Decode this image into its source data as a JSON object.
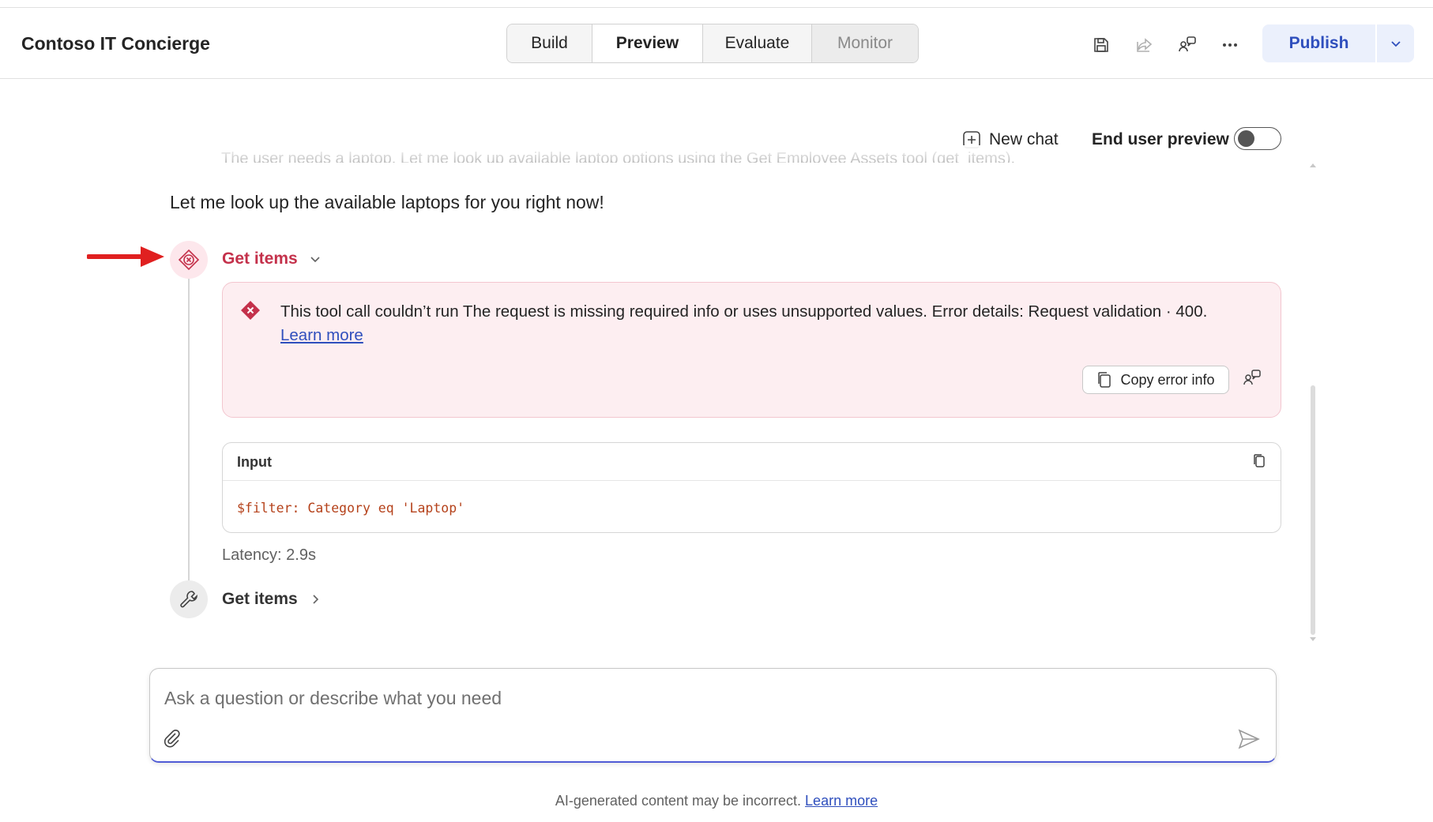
{
  "app": {
    "title": "Contoso IT Concierge"
  },
  "tabs": [
    {
      "label": "Build"
    },
    {
      "label": "Preview"
    },
    {
      "label": "Evaluate"
    },
    {
      "label": "Monitor"
    }
  ],
  "toolbar": {
    "icons": [
      "save-icon",
      "share-icon",
      "feedback-icon",
      "more-icon"
    ],
    "publish_label": "Publish"
  },
  "chat": {
    "new_chat_label": "New chat",
    "end_user_preview_label": "End user preview",
    "end_user_preview_on": false,
    "faded_text": "The user needs a laptop. Let me look up available laptop options using the Get Employee Assets tool (get_items).",
    "message": "Let me look up the available laptops for you right now!",
    "step1": {
      "title": "Get items",
      "error_text": "This tool call couldn’t run The request is missing required info or uses unsupported values. Error details: Request validation · 400.",
      "learn_more": "Learn more",
      "copy_label": "Copy error info",
      "input_label": "Input",
      "input_code": "$filter: Category eq 'Laptop'",
      "latency": "Latency: 2.9s"
    },
    "step2": {
      "title": "Get items"
    }
  },
  "composer": {
    "placeholder": "Ask a question or describe what you need"
  },
  "footer": {
    "text": "AI-generated content may be incorrect. ",
    "link": "Learn more"
  },
  "colors": {
    "accent": "#2f4fbd",
    "error": "#c4314b",
    "error_bg": "#fdeef1",
    "arrow": "#e02020"
  }
}
